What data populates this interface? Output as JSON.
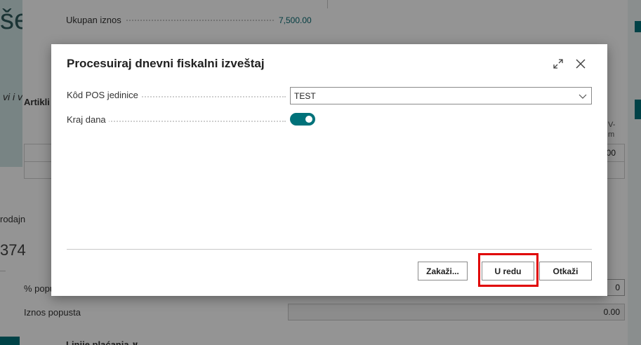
{
  "background": {
    "hero_title": "šeg",
    "hero_subtitle": "vi i v",
    "total_label": "Ukupan iznos",
    "total_value": "7,500.00",
    "section_label": "Artikli",
    "side_label": "rodajn",
    "big_number": "374",
    "discount_pct_label": "% popu",
    "discount_pct_value": "0",
    "discount_amount_label": "Iznos popusta",
    "discount_amount_value": "0.00",
    "table_cell_value": "00",
    "col_header_top": "V-",
    "col_header_bottom": "m",
    "payment_lines_label": "Linije plaćanja ∨"
  },
  "dialog": {
    "title": "Procesuiraj dnevni fiskalni izveštaj",
    "fields": {
      "pos_unit": {
        "label": "Kôd POS jedinice",
        "value": "TEST"
      },
      "end_of_day": {
        "label": "Kraj dana",
        "on": true
      }
    },
    "buttons": {
      "show": "Zakaži...",
      "ok": "U redu",
      "cancel": "Otkaži"
    }
  },
  "colors": {
    "accent": "#00727a",
    "highlight": "#e00000",
    "link_value": "#0a6b73"
  }
}
